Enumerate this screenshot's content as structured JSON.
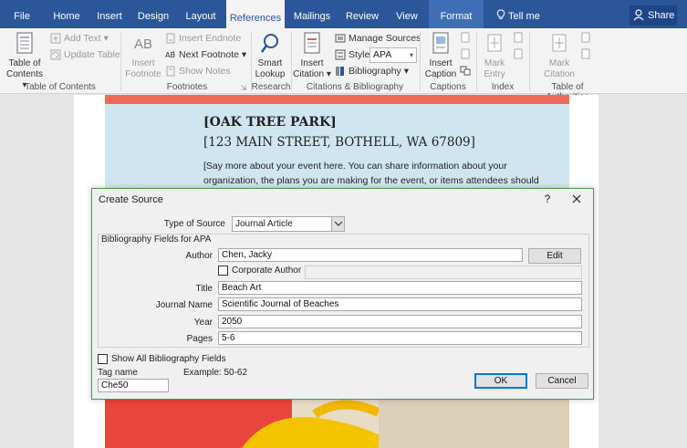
{
  "ribbon_tabs": [
    {
      "label": "File"
    },
    {
      "label": "Home"
    },
    {
      "label": "Insert"
    },
    {
      "label": "Design"
    },
    {
      "label": "Layout"
    },
    {
      "label": "References"
    },
    {
      "label": "Mailings"
    },
    {
      "label": "Review"
    },
    {
      "label": "View"
    },
    {
      "label": "Format"
    }
  ],
  "active_tab": "References",
  "tell_me": "Tell me",
  "share": "Share",
  "ribbon": {
    "toc": {
      "line1": "Table of",
      "line2": "Contents",
      "add_text": "Add Text",
      "update_table": "Update Table",
      "group": "Table of Contents"
    },
    "footnotes": {
      "ab_label": "AB",
      "insert_line1": "Insert",
      "insert_line2": "Footnote",
      "insert_endnote": "Insert Endnote",
      "next_footnote": "Next Footnote",
      "show_notes": "Show Notes",
      "group": "Footnotes"
    },
    "research": {
      "line1": "Smart",
      "line2": "Lookup",
      "group": "Research"
    },
    "citations": {
      "insert_line1": "Insert",
      "insert_line2": "Citation",
      "manage_sources": "Manage Sources",
      "style_label": "Style:",
      "style_value": "APA",
      "bibliography": "Bibliography",
      "group": "Citations & Bibliography"
    },
    "captions": {
      "line1": "Insert",
      "line2": "Caption",
      "group": "Captions"
    },
    "index": {
      "line1": "Mark",
      "line2": "Entry",
      "group": "Index"
    },
    "authorities": {
      "line1": "Mark",
      "line2": "Citation",
      "group": "Table of Authorities"
    }
  },
  "document": {
    "title": "[OAK TREE PARK]",
    "address": "[123 MAIN STREET, BOTHELL, WA 67809]",
    "body": "[Say more about your event here. You can share information about your organization, the plans you are making for the event, or items attendees should bring. If you do not"
  },
  "dialog": {
    "title": "Create Source",
    "help": "?",
    "type_of_source_label": "Type of Source",
    "type_of_source_value": "Journal Article",
    "fields_group_label": "Bibliography Fields for APA",
    "author_label": "Author",
    "author_value": "Chen, Jacky",
    "edit_button": "Edit",
    "corporate_author_label": "Corporate Author",
    "title_label": "Title",
    "title_value": "Beach Art",
    "journal_name_label": "Journal Name",
    "journal_name_value": "Scientific Journal of Beaches",
    "year_label": "Year",
    "year_value": "2050",
    "pages_label": "Pages",
    "pages_value": "5-6",
    "show_all_label": "Show All Bibliography Fields",
    "tag_name_label": "Tag name",
    "tag_name_value": "Che50",
    "example_label": "Example: 50-62",
    "ok_button": "OK",
    "cancel_button": "Cancel"
  },
  "colors": {
    "ribbon_blue": "#2b579a",
    "banner_red": "#ee6b5b",
    "banner_blue": "#cfe6f1",
    "dialog_border": "#4a9a4a",
    "default_button": "#0078d7"
  }
}
